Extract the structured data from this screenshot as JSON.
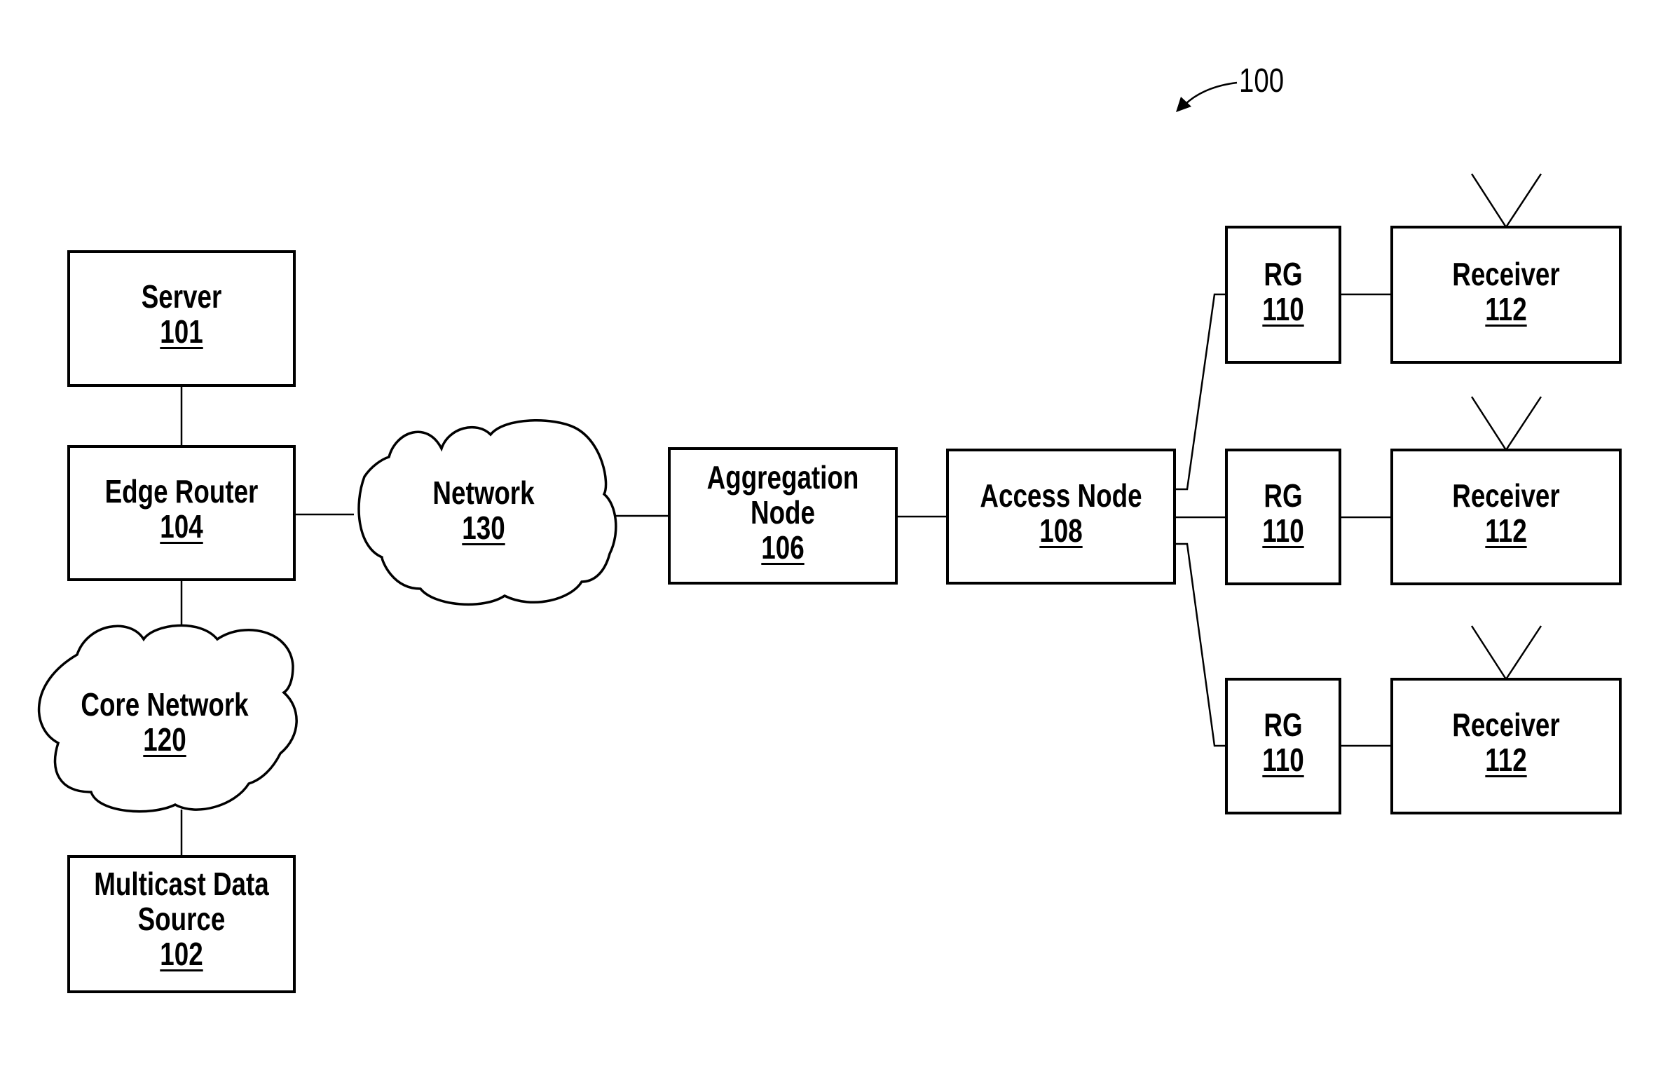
{
  "figure_ref": "100",
  "nodes": {
    "server": {
      "name": "Server",
      "num": "101"
    },
    "edge_router": {
      "name": "Edge Router",
      "num": "104"
    },
    "multicast": {
      "name1": "Multicast Data",
      "name2": "Source",
      "num": "102"
    },
    "core_network": {
      "name": "Core Network",
      "num": "120"
    },
    "network": {
      "name": "Network",
      "num": "130"
    },
    "aggregation": {
      "name1": "Aggregation",
      "name2": "Node",
      "num": "106"
    },
    "access": {
      "name": "Access Node",
      "num": "108"
    },
    "rg": [
      {
        "name": "RG",
        "num": "110"
      },
      {
        "name": "RG",
        "num": "110"
      },
      {
        "name": "RG",
        "num": "110"
      }
    ],
    "receivers": [
      {
        "name": "Receiver",
        "num": "112"
      },
      {
        "name": "Receiver",
        "num": "112"
      },
      {
        "name": "Receiver",
        "num": "112"
      }
    ]
  }
}
